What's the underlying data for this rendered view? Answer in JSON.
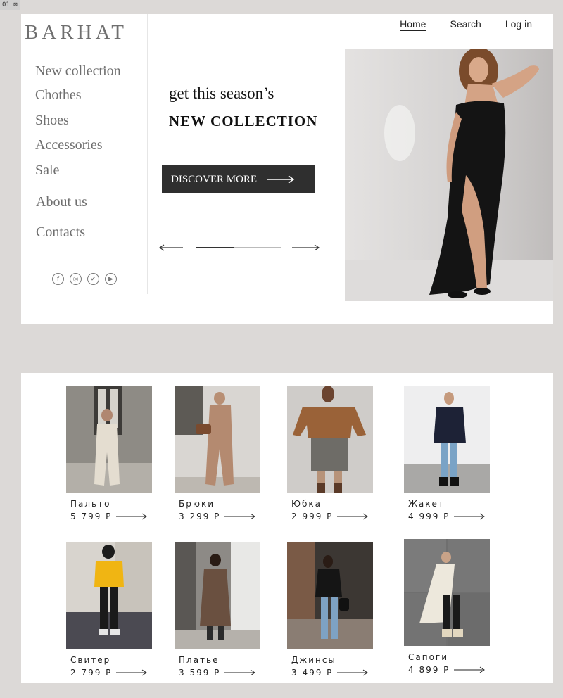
{
  "corner_tag": "01 ⊠",
  "brand": {
    "logo": "BARHAT"
  },
  "topnav": {
    "home": "Home",
    "search": "Search",
    "login": "Log in"
  },
  "sidebar": {
    "items": [
      {
        "label": "New collection"
      },
      {
        "label": "Chothes"
      },
      {
        "label": "Shoes"
      },
      {
        "label": "Accessories"
      },
      {
        "label": "Sale"
      },
      {
        "label": "About us"
      },
      {
        "label": "Contacts"
      }
    ],
    "social": [
      "facebook-icon",
      "instagram-icon",
      "twitter-icon",
      "youtube-icon"
    ]
  },
  "hero": {
    "tagline_line1": "get this season’s",
    "tagline_line2": "NEW COLLECTION",
    "cta": "DISCOVER MORE",
    "slider_progress": 0.45
  },
  "products": [
    {
      "name": "Пальто",
      "price": "5 799 Р"
    },
    {
      "name": "Брюки",
      "price": "3 299 Р"
    },
    {
      "name": "Юбка",
      "price": "2 999 Р"
    },
    {
      "name": "Жакет",
      "price": "4 999 Р"
    },
    {
      "name": "Свитер",
      "price": "2 799 Р"
    },
    {
      "name": "Платье",
      "price": "3 599 Р"
    },
    {
      "name": "Джинсы",
      "price": "3 499 Р"
    },
    {
      "name": "Сапоги",
      "price": "4 899 Р"
    }
  ],
  "colors": {
    "background": "#dcd9d7",
    "cta_bg": "#2f2f2f",
    "nav_text": "#6f6f6f"
  }
}
